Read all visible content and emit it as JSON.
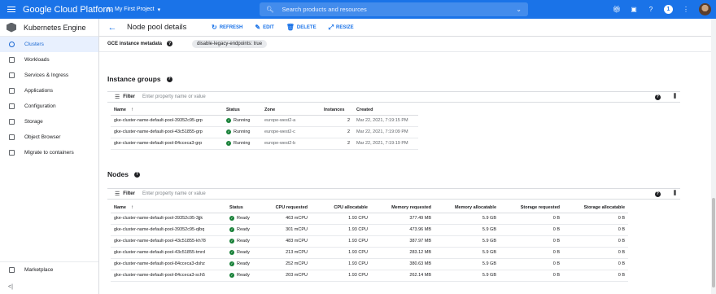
{
  "topbar": {
    "brand": "Google Cloud Platform",
    "project": "My First Project",
    "search_placeholder": "Search products and resources",
    "notification_count": "1"
  },
  "sidebar": {
    "title": "Kubernetes Engine",
    "items": [
      {
        "label": "Clusters",
        "active": true
      },
      {
        "label": "Workloads"
      },
      {
        "label": "Services & Ingress"
      },
      {
        "label": "Applications"
      },
      {
        "label": "Configuration"
      },
      {
        "label": "Storage"
      },
      {
        "label": "Object Browser"
      },
      {
        "label": "Migrate to containers"
      }
    ],
    "marketplace": "Marketplace",
    "collapse": "<|"
  },
  "actionbar": {
    "title": "Node pool details",
    "refresh": "REFRESH",
    "edit": "EDIT",
    "delete": "DELETE",
    "resize": "RESIZE"
  },
  "metadata": {
    "label": "GCE instance metadata",
    "chip": "disable-legacy-endpoints: true"
  },
  "instance_groups": {
    "title": "Instance groups",
    "filter_label": "Filter",
    "filter_placeholder": "Enter property name or value",
    "columns": [
      "Name",
      "Status",
      "Zone",
      "Instances",
      "Created"
    ],
    "rows": [
      [
        "gke-cluster-name-default-pool-39352c95-grp",
        "Running",
        "europe-west2-a",
        "2",
        "Mar 22, 2021, 7:19:15 PM"
      ],
      [
        "gke-cluster-name-default-pool-43c51855-grp",
        "Running",
        "europe-west2-c",
        "2",
        "Mar 22, 2021, 7:19:09 PM"
      ],
      [
        "gke-cluster-name-default-pool-84cceca3-grp",
        "Running",
        "europe-west2-b",
        "2",
        "Mar 22, 2021, 7:19:19 PM"
      ]
    ]
  },
  "nodes": {
    "title": "Nodes",
    "filter_label": "Filter",
    "filter_placeholder": "Enter property name or value",
    "columns": [
      "Name",
      "Status",
      "CPU requested",
      "CPU allocatable",
      "Memory requested",
      "Memory allocatable",
      "Storage requested",
      "Storage allocatable"
    ],
    "rows": [
      [
        "gke-cluster-name-default-pool-39352c95-3jjk",
        "Ready",
        "463 mCPU",
        "1.93 CPU",
        "377.49 MB",
        "5.9 GB",
        "0 B",
        "0 B"
      ],
      [
        "gke-cluster-name-default-pool-39352c95-qlbq",
        "Ready",
        "301 mCPU",
        "1.93 CPU",
        "473.96 MB",
        "5.9 GB",
        "0 B",
        "0 B"
      ],
      [
        "gke-cluster-name-default-pool-43c51855-kh78",
        "Ready",
        "483 mCPU",
        "1.93 CPU",
        "387.97 MB",
        "5.9 GB",
        "0 B",
        "0 B"
      ],
      [
        "gke-cluster-name-default-pool-43c51855-tmrd",
        "Ready",
        "213 mCPU",
        "1.93 CPU",
        "283.12 MB",
        "5.9 GB",
        "0 B",
        "0 B"
      ],
      [
        "gke-cluster-name-default-pool-84cceca3-dshz",
        "Ready",
        "252 mCPU",
        "1.93 CPU",
        "380.63 MB",
        "5.9 GB",
        "0 B",
        "0 B"
      ],
      [
        "gke-cluster-name-default-pool-84cceca3-sch5",
        "Ready",
        "203 mCPU",
        "1.93 CPU",
        "262.14 MB",
        "5.9 GB",
        "0 B",
        "0 B"
      ]
    ]
  },
  "colors": {
    "accent": "#1a73e8",
    "ok": "#188038"
  }
}
